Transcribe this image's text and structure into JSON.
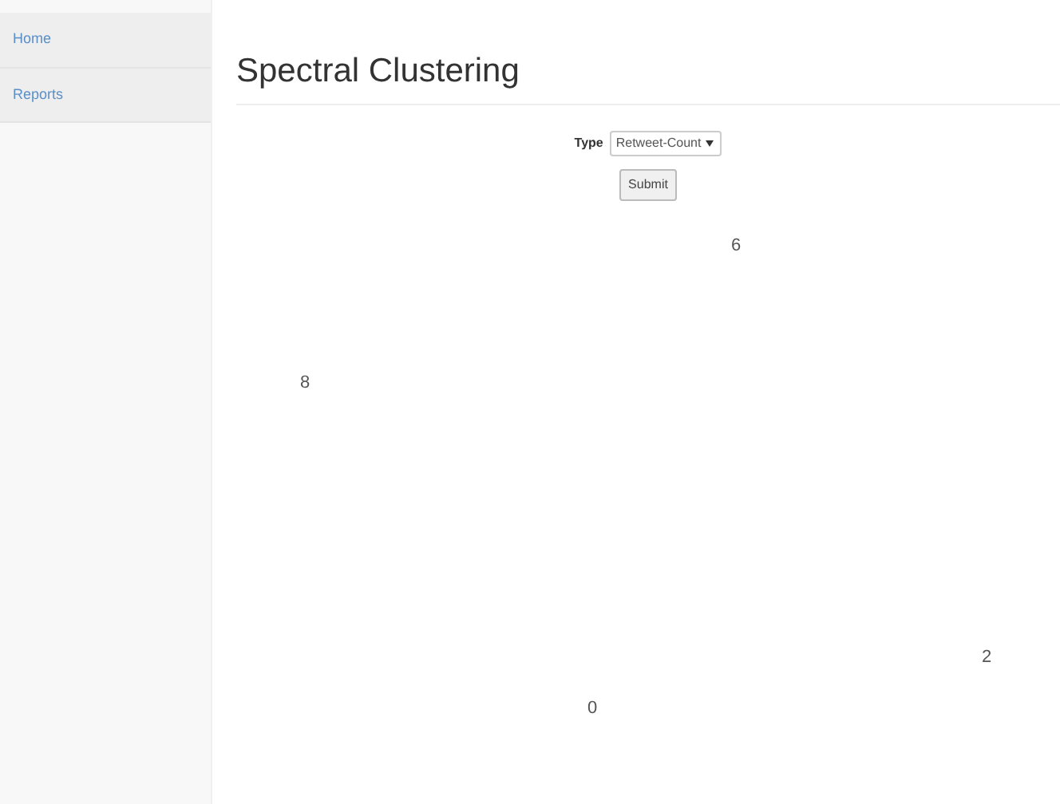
{
  "sidebar": {
    "items": [
      {
        "label": "Home"
      },
      {
        "label": "Reports"
      }
    ]
  },
  "title": "Spectral Clustering",
  "form": {
    "label": "Type",
    "value": "Retweet-Count",
    "submit": "Submit"
  },
  "graph": {
    "node_labels": [
      "6",
      "8",
      "2",
      "0"
    ]
  }
}
